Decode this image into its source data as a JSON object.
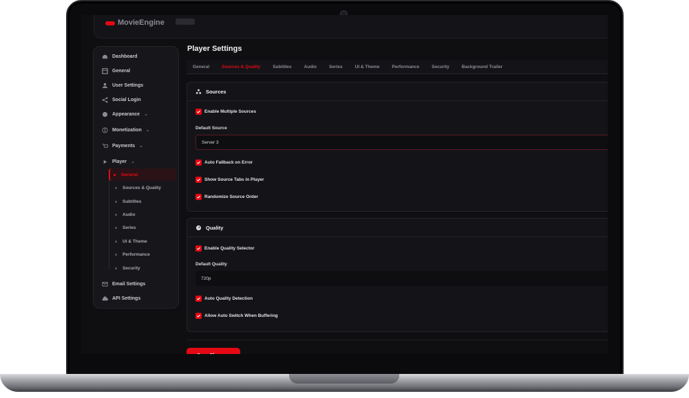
{
  "brand": {
    "name": "MovieEngine"
  },
  "sidebar": {
    "items": [
      {
        "label": "Dashboard"
      },
      {
        "label": "General"
      },
      {
        "label": "User Settings"
      },
      {
        "label": "Social Login"
      },
      {
        "label": "Appearance"
      },
      {
        "label": "Monetization"
      },
      {
        "label": "Payments"
      },
      {
        "label": "Player"
      },
      {
        "label": "Email Settings"
      },
      {
        "label": "API Settings"
      }
    ],
    "player_sub": [
      {
        "label": "General"
      },
      {
        "label": "Sources & Quality"
      },
      {
        "label": "Subtitles"
      },
      {
        "label": "Audio"
      },
      {
        "label": "Series"
      },
      {
        "label": "UI & Theme"
      },
      {
        "label": "Performance"
      },
      {
        "label": "Security"
      }
    ]
  },
  "page": {
    "title": "Player Settings"
  },
  "tabs": [
    "General",
    "Sources & Quality",
    "Subtitles",
    "Audio",
    "Series",
    "UI & Theme",
    "Performance",
    "Security",
    "Background Trailer"
  ],
  "sources": {
    "title": "Sources",
    "enable_multiple": "Enable Multiple Sources",
    "default_source_label": "Default Source",
    "default_source_value": "Server 3",
    "auto_fallback": "Auto Fallback on Error",
    "show_tabs": "Show Source Tabs in Player",
    "randomize": "Randomize Source Order"
  },
  "quality": {
    "title": "Quality",
    "enable_selector": "Enable Quality Selector",
    "default_quality_label": "Default Quality",
    "default_quality_value": "720p",
    "auto_detect": "Auto Quality Detection",
    "auto_switch": "Allow Auto Switch When Buffering"
  },
  "actions": {
    "save": "Save Changes"
  },
  "colors": {
    "accent": "#e50914",
    "background": "#0f0f12",
    "card": "#141418"
  }
}
